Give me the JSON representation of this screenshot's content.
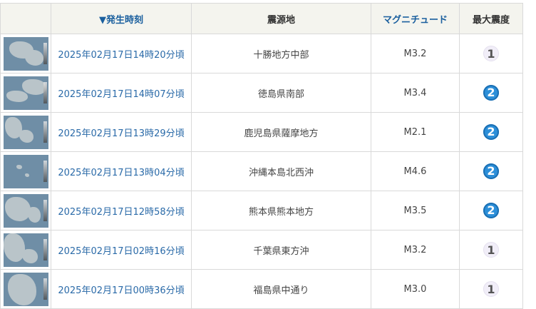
{
  "headers": {
    "time": "▼発生時刻",
    "place": "震源地",
    "magnitude": "マグニチュード",
    "intensity": "最大震度"
  },
  "rows": [
    {
      "time": "2025年02月17日14時20分頃",
      "place": "十勝地方中部",
      "magnitude": "M3.2",
      "intensity": "1"
    },
    {
      "time": "2025年02月17日14時07分頃",
      "place": "徳島県南部",
      "magnitude": "M3.4",
      "intensity": "2"
    },
    {
      "time": "2025年02月17日13時29分頃",
      "place": "鹿児島県薩摩地方",
      "magnitude": "M2.1",
      "intensity": "2"
    },
    {
      "time": "2025年02月17日13時04分頃",
      "place": "沖縄本島北西沖",
      "magnitude": "M4.6",
      "intensity": "2"
    },
    {
      "time": "2025年02月17日12時58分頃",
      "place": "熊本県熊本地方",
      "magnitude": "M3.5",
      "intensity": "2"
    },
    {
      "time": "2025年02月17日02時16分頃",
      "place": "千葉県東方沖",
      "magnitude": "M3.2",
      "intensity": "1"
    },
    {
      "time": "2025年02月17日00時36分頃",
      "place": "福島県中通り",
      "magnitude": "M3.0",
      "intensity": "1"
    }
  ],
  "colors": {
    "header_bg": "#f4f4ee",
    "link": "#2a6aa8",
    "intensity_1": "#f1eef8",
    "intensity_2": "#2c8fd9"
  }
}
